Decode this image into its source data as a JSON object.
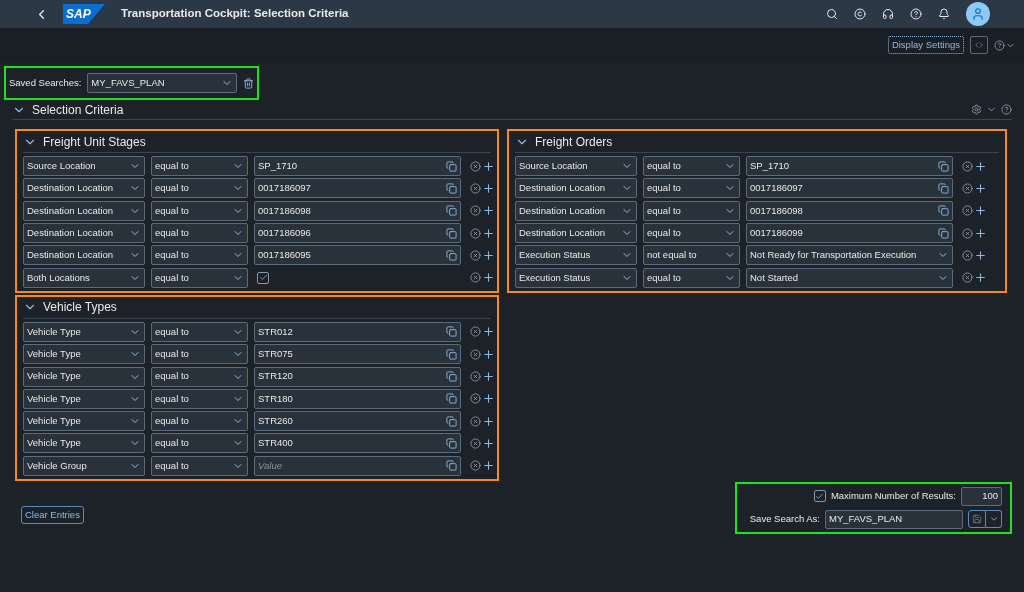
{
  "shell": {
    "logo": "SAP",
    "title": "Transportation Cockpit: Selection Criteria"
  },
  "toolbar": {
    "display_settings": "Display Settings"
  },
  "saved_searches": {
    "label": "Saved Searches:",
    "value": "MY_FAVS_PLAN",
    "highlighted": true
  },
  "selection_criteria": {
    "title": "Selection Criteria",
    "expanded": true
  },
  "left_sections": [
    {
      "title": "Freight Unit Stages",
      "expanded": true,
      "highlighted": true,
      "rows": [
        {
          "kind": "input",
          "attribute": "Source Location",
          "operator": "equal to",
          "value": "SP_1710"
        },
        {
          "kind": "input",
          "attribute": "Destination Location",
          "operator": "equal to",
          "value": "0017186097"
        },
        {
          "kind": "input",
          "attribute": "Destination Location",
          "operator": "equal to",
          "value": "0017186098"
        },
        {
          "kind": "input",
          "attribute": "Destination Location",
          "operator": "equal to",
          "value": "0017186096"
        },
        {
          "kind": "input",
          "attribute": "Destination Location",
          "operator": "equal to",
          "value": "0017186095"
        },
        {
          "kind": "checkbox",
          "attribute": "Both Locations",
          "operator": "equal to",
          "checked": true
        }
      ]
    },
    {
      "title": "Vehicle Types",
      "expanded": true,
      "highlighted": true,
      "rows": [
        {
          "kind": "input",
          "attribute": "Vehicle Type",
          "operator": "equal to",
          "value": "STR012"
        },
        {
          "kind": "input",
          "attribute": "Vehicle Type",
          "operator": "equal to",
          "value": "STR075"
        },
        {
          "kind": "input",
          "attribute": "Vehicle Type",
          "operator": "equal to",
          "value": "STR120"
        },
        {
          "kind": "input",
          "attribute": "Vehicle Type",
          "operator": "equal to",
          "value": "STR180"
        },
        {
          "kind": "input",
          "attribute": "Vehicle Type",
          "operator": "equal to",
          "value": "STR260"
        },
        {
          "kind": "input",
          "attribute": "Vehicle Type",
          "operator": "equal to",
          "value": "STR400"
        },
        {
          "kind": "input",
          "attribute": "Vehicle Group",
          "operator": "equal to",
          "placeholder": "Value"
        }
      ]
    }
  ],
  "right_sections": [
    {
      "title": "Freight Orders",
      "expanded": true,
      "highlighted": true,
      "rows": [
        {
          "kind": "input",
          "attribute": "Source Location",
          "operator": "equal to",
          "value": "SP_1710"
        },
        {
          "kind": "input",
          "attribute": "Destination Location",
          "operator": "equal to",
          "value": "0017186097"
        },
        {
          "kind": "input",
          "attribute": "Destination Location",
          "operator": "equal to",
          "value": "0017186098"
        },
        {
          "kind": "input",
          "attribute": "Destination Location",
          "operator": "equal to",
          "value": "0017186099"
        },
        {
          "kind": "select",
          "attribute": "Execution Status",
          "operator": "not equal to",
          "value": "Not Ready for Transportation Execution"
        },
        {
          "kind": "select",
          "attribute": "Execution Status",
          "operator": "equal to",
          "value": "Not Started"
        }
      ]
    }
  ],
  "clear_entries": "Clear Entries",
  "footer": {
    "highlighted": true,
    "max_results": {
      "checked": true,
      "label": "Maximum Number of Results:",
      "value": "100"
    },
    "save_as": {
      "label": "Save Search As:",
      "value": "MY_FAVS_PLAN"
    }
  }
}
